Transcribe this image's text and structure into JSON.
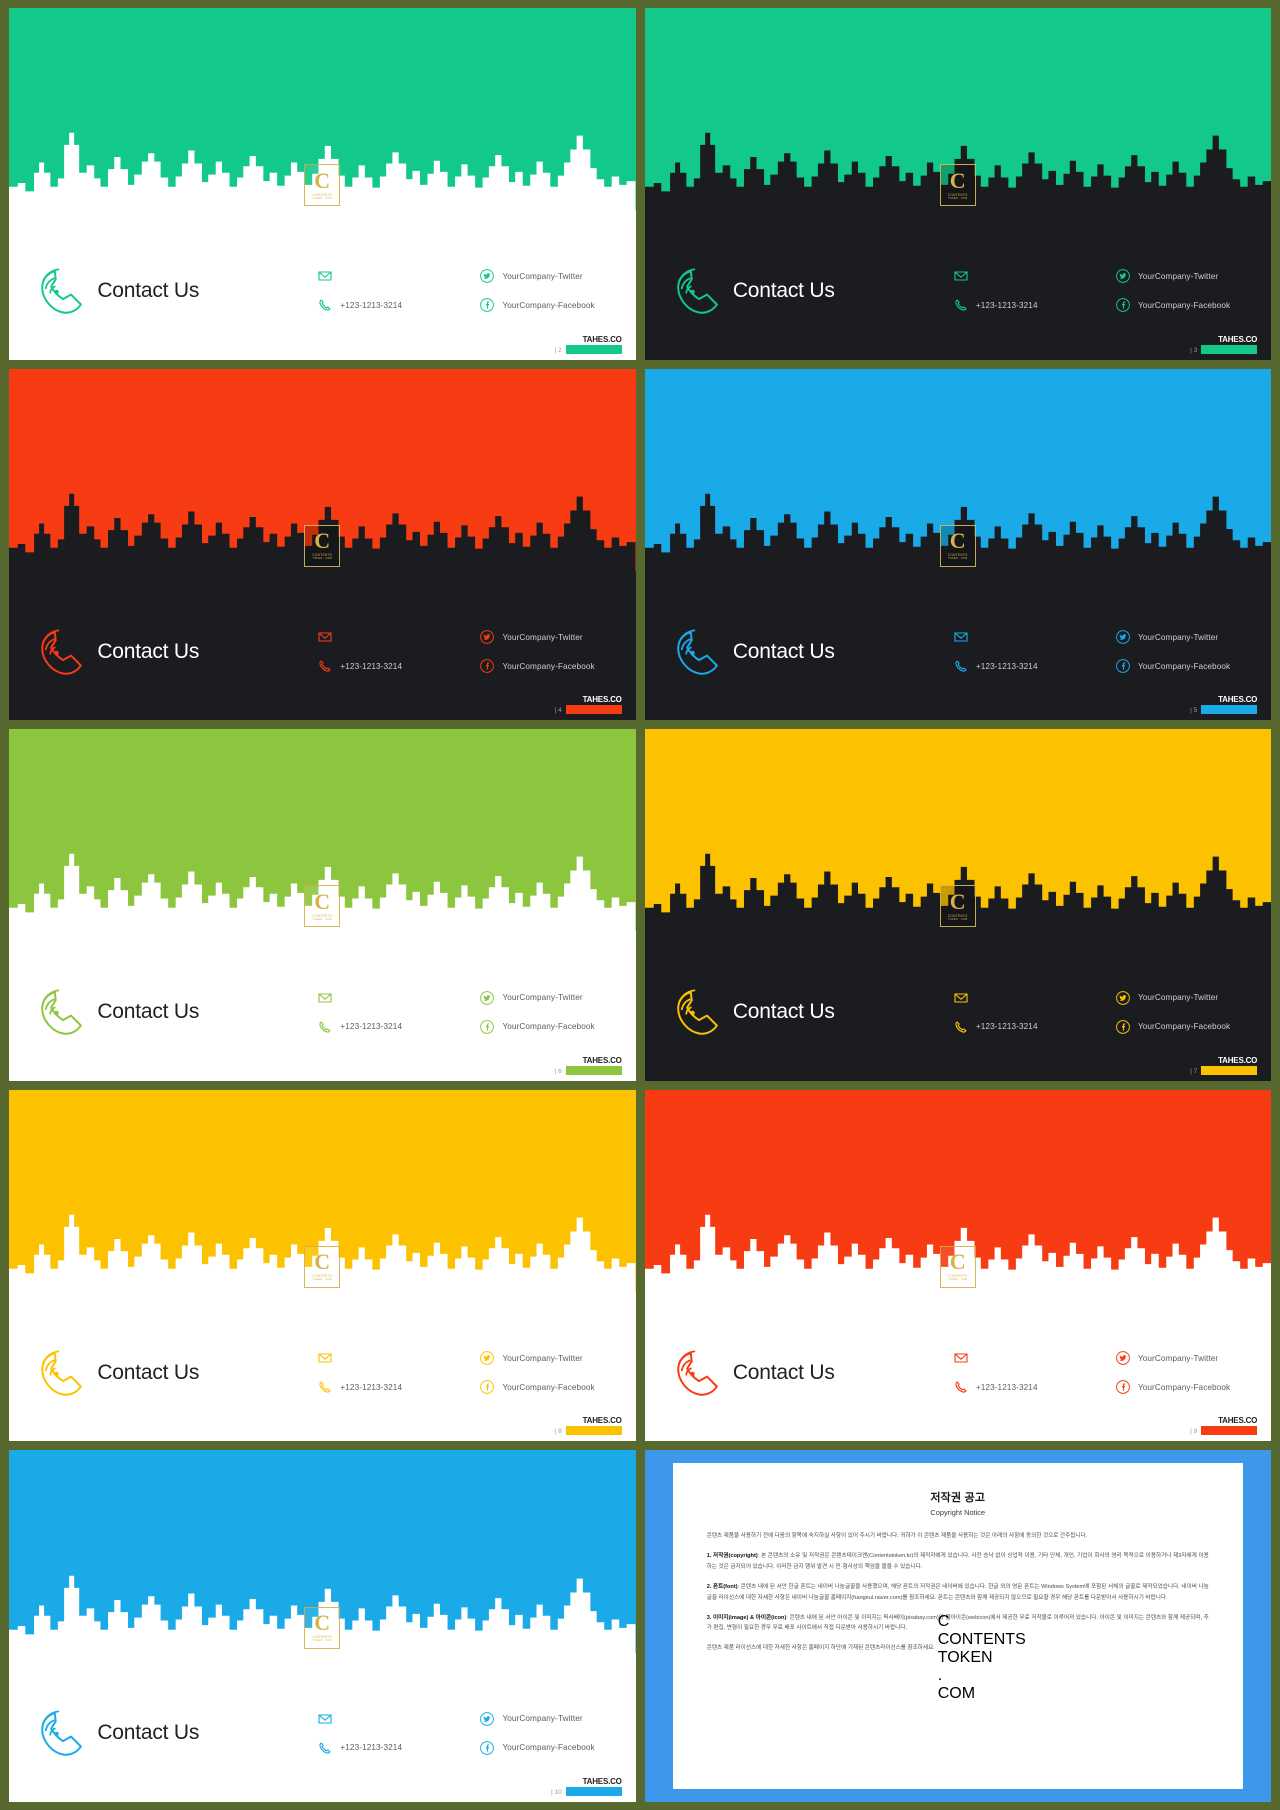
{
  "page": {
    "background_color": "#58692f",
    "brand_word": "TAHES.CO"
  },
  "labels": {
    "contact_title": "Contact Us",
    "phone": "+123-1213-3214",
    "twitter": "YourCompany-Twitter",
    "facebook": "YourCompany-Facebook",
    "email": "",
    "logo_letter": "C",
    "logo_line1": "CONTENTS",
    "logo_line2": "TOKEN . COM"
  },
  "icons": {
    "phone_large": "phone-handset-icon",
    "envelope": "envelope-icon",
    "phone_small": "phone-icon",
    "twitter": "twitter-icon",
    "facebook": "facebook-icon"
  },
  "slides": [
    {
      "id": "slide-2",
      "number": "| 2",
      "theme": "light",
      "accent": "#12c989",
      "sky_mode": "cut-white",
      "sky_color": "#ffffff",
      "band_color": "#ffffff",
      "top_color": "#12c989"
    },
    {
      "id": "slide-3",
      "number": "| 3",
      "theme": "dark",
      "accent": "#12c989",
      "sky_mode": "dark-on-color",
      "sky_color": "#1b1c20",
      "band_color": "#1b1c20",
      "top_color": "#12c989"
    },
    {
      "id": "slide-4",
      "number": "| 4",
      "theme": "dark",
      "accent": "#f73b13",
      "sky_mode": "dark-on-color",
      "sky_color": "#1b1c20",
      "band_color": "#1b1c20",
      "top_color": "#f73b13"
    },
    {
      "id": "slide-5",
      "number": "| 5",
      "theme": "dark",
      "accent": "#1aaae8",
      "sky_mode": "dark-on-color",
      "sky_color": "#1b1c20",
      "band_color": "#1b1c20",
      "top_color": "#1aaae8"
    },
    {
      "id": "slide-6",
      "number": "| 6",
      "theme": "light",
      "accent": "#8cc63e",
      "sky_mode": "cut-white",
      "sky_color": "#ffffff",
      "band_color": "#ffffff",
      "top_color": "#8cc63e"
    },
    {
      "id": "slide-7",
      "number": "| 7",
      "theme": "dark",
      "accent": "#fcc200",
      "sky_mode": "dark-on-color",
      "sky_color": "#1b1c20",
      "band_color": "#1b1c20",
      "top_color": "#fcc200"
    },
    {
      "id": "slide-8",
      "number": "| 8",
      "theme": "light",
      "accent": "#fcc200",
      "sky_mode": "cut-white",
      "sky_color": "#ffffff",
      "band_color": "#ffffff",
      "top_color": "#fcc200"
    },
    {
      "id": "slide-9",
      "number": "| 9",
      "theme": "light",
      "accent": "#f73b13",
      "sky_mode": "cut-white",
      "sky_color": "#ffffff",
      "band_color": "#ffffff",
      "top_color": "#f73b13"
    },
    {
      "id": "slide-10",
      "number": "| 10",
      "theme": "light",
      "accent": "#1aaae8",
      "sky_mode": "cut-white",
      "sky_color": "#ffffff",
      "band_color": "#ffffff",
      "top_color": "#1aaae8"
    }
  ],
  "copyright": {
    "frame_color": "#3d98eb",
    "title_ko": "저작권 공고",
    "title_en": "Copyright Notice",
    "intro": "콘텐츠 제품을 사용하기 전에 다음의 항목에 숙지하실 사항이 있어 주시기 바랍니다. 귀하가 이 콘텐츠 제품을 사용하는 것은 아래의 사항에 동의한 것으로 간주됩니다.",
    "sections": [
      {
        "heading": "1. 저작권(copyright)",
        "body": ": 본 콘텐츠의 소유 및 저작권은 콘텐츠테이크앤(Contentstoken.kr)의 제작자에게 있습니다. 사전 승낙 없이 상업적 이용, 기타 단체, 개인, 기업이 회사의 영리 목적으로 이용하거나 제3자에게 이용하는 것은 금지되어 있습니다. 이러한 금지 행위 발견 시 민·형사상의 책임을 물을 수 있습니다."
      },
      {
        "heading": "2. 폰트(font)",
        "body": ": 콘텐츠 내에 된 서안 한글 폰트는 네이버 나눔글꼴을 사용했으며, 해당 폰트의 저작권은 네이버에 있습니다. 한글 외의 영문 폰트는 Windows System에 포함된 서체의 글꼴로 제작되었습니다. 네이버 나눔글꼴 라이선스에 대한 자세한 사항은 네이버 나눔글꼴 홈페이지(hangeul.naver.com)를 참조하세요. 폰트는 콘텐츠와 함께 제공되지 않으므로 필요할 경우 해당 폰트를 다운받아서 사용하시기 바랍니다."
      },
      {
        "heading": "3. 이미지(image) & 아이콘(icon)",
        "body": ": 콘텐츠 내에 된 서안 아이콘 및 이미지는 픽사베이(pixabay.com)와 웹아이콘(webicon)에서 제공한 무료 저작물로 이루어져 있습니다. 아이콘 및 이미지는 콘텐츠와 함께 제공되며, 추가 편집, 변형이 필요한 경우 무료 배포 사이트에서 직접 다운받아 사용하시기 바랍니다."
      }
    ],
    "footer": "콘텐츠 제품 라이선스에 대한 자세한 사항은 홈페이지 하단에 기재된 콘텐츠라이선스를 참조하세요."
  }
}
